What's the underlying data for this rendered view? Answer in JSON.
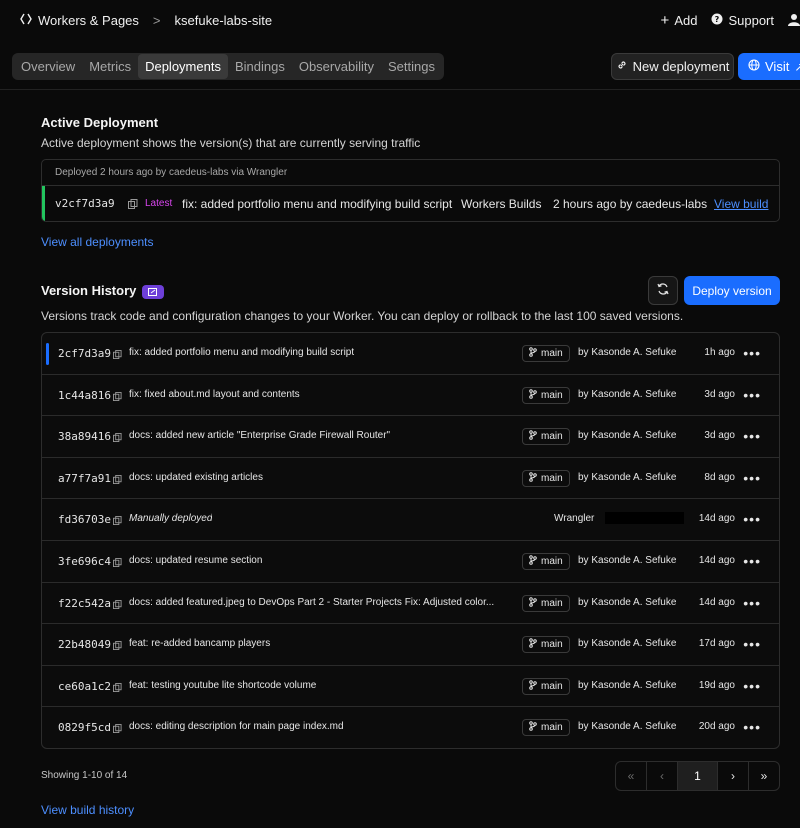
{
  "topbar": {
    "breadcrumb_root": "Workers & Pages",
    "breadcrumb_sep": ">",
    "project": "ksefuke-labs-site",
    "add_label": "Add",
    "support_label": "Support"
  },
  "tabs": [
    {
      "label": "Overview"
    },
    {
      "label": "Metrics"
    },
    {
      "label": "Deployments"
    },
    {
      "label": "Bindings"
    },
    {
      "label": "Observability"
    },
    {
      "label": "Settings"
    }
  ],
  "actions": {
    "new_deployment": "New deployment",
    "visit": "Visit"
  },
  "active": {
    "title": "Active Deployment",
    "subtitle": "Active deployment shows the version(s) that are currently serving traffic",
    "deployed_note": "Deployed 2 hours ago by caedeus-labs via Wrangler",
    "hash": "v2cf7d3a9",
    "latest": "Latest",
    "message": "fix: added portfolio menu and modifying build script",
    "source": "Workers Builds",
    "when": "2 hours ago by caedeus-labs",
    "view_build": "View build",
    "view_all": "View all deployments"
  },
  "history": {
    "title": "Version History",
    "subtitle": "Versions track code and configuration changes to your Worker. You can deploy or rollback to the last 100 saved versions.",
    "deploy_version": "Deploy version",
    "rows": [
      {
        "hash": "2cf7d3a9",
        "message": "fix: added portfolio menu and modifying build script",
        "branch": "main",
        "author": "by Kasonde A. Sefuke",
        "time": "1h ago"
      },
      {
        "hash": "1c44a816",
        "message": "fix: fixed about.md layout and contents",
        "branch": "main",
        "author": "by Kasonde A. Sefuke",
        "time": "3d ago"
      },
      {
        "hash": "38a89416",
        "message": "docs: added new article \"Enterprise Grade Firewall Router\"",
        "branch": "main",
        "author": "by Kasonde A. Sefuke",
        "time": "3d ago"
      },
      {
        "hash": "a77f7a91",
        "message": "docs: updated existing articles",
        "branch": "main",
        "author": "by Kasonde A. Sefuke",
        "time": "8d ago"
      },
      {
        "hash": "fd36703e",
        "message": "Manually deployed",
        "wrangler": "Wrangler",
        "time": "14d ago"
      },
      {
        "hash": "3fe696c4",
        "message": "docs: updated resume section",
        "branch": "main",
        "author": "by Kasonde A. Sefuke",
        "time": "14d ago"
      },
      {
        "hash": "f22c542a",
        "message": "docs: added featured.jpeg to DevOps Part 2 - Starter Projects Fix: Adjusted color...",
        "branch": "main",
        "author": "by Kasonde A. Sefuke",
        "time": "14d ago"
      },
      {
        "hash": "22b48049",
        "message": "feat: re-added bancamp players",
        "branch": "main",
        "author": "by Kasonde A. Sefuke",
        "time": "17d ago"
      },
      {
        "hash": "ce60a1c2",
        "message": "feat: testing youtube lite shortcode volume",
        "branch": "main",
        "author": "by Kasonde A. Sefuke",
        "time": "19d ago"
      },
      {
        "hash": "0829f5cd",
        "message": "docs: editing description for main page index.md",
        "branch": "main",
        "author": "by Kasonde A. Sefuke",
        "time": "20d ago"
      }
    ],
    "showing": "Showing 1-10 of 14",
    "page": "1",
    "view_build_history": "View build history"
  },
  "colors": {
    "accent": "#1a6dff",
    "active_border": "#22c55e",
    "latest_badge": "#c026d3",
    "history_badge": "#6d3fd8"
  }
}
